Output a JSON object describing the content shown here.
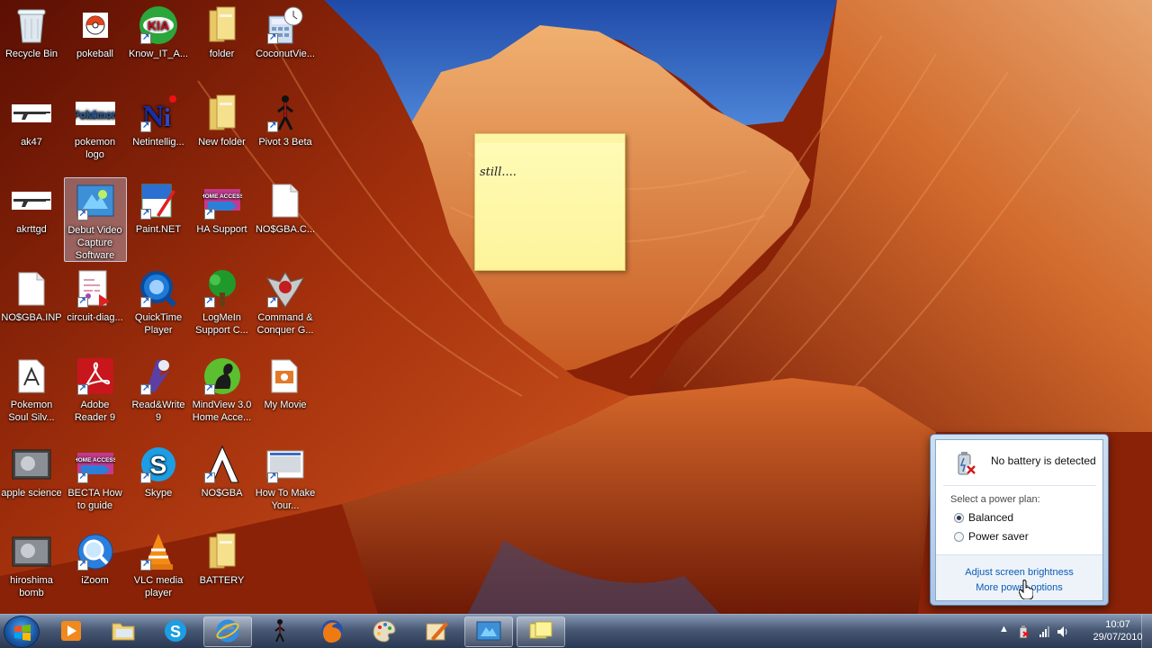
{
  "desktop": {
    "icons": [
      {
        "label": "Recycle Bin",
        "icon": "recycle-bin-icon"
      },
      {
        "label": "pokeball",
        "icon": "pokeball-icon"
      },
      {
        "label": "Know_IT_A...",
        "icon": "kia-icon"
      },
      {
        "label": "folder",
        "icon": "folder-icon"
      },
      {
        "label": "CoconutVie...",
        "icon": "calculator-icon"
      },
      {
        "label": "ak47",
        "icon": "rifle-icon"
      },
      {
        "label": "pokemon logo",
        "icon": "pokemon-logo-icon"
      },
      {
        "label": "Netintellig...",
        "icon": "netintelligence-icon"
      },
      {
        "label": "New folder",
        "icon": "folder-icon"
      },
      {
        "label": "Pivot 3 Beta",
        "icon": "stick-figure-icon"
      },
      {
        "label": "akrttgd",
        "icon": "rifle-icon"
      },
      {
        "label": "Debut Video Capture Software",
        "icon": "debut-video-icon"
      },
      {
        "label": "Paint.NET",
        "icon": "paint-net-icon"
      },
      {
        "label": "HA Support",
        "icon": "home-access-icon"
      },
      {
        "label": "NO$GBA.C...",
        "icon": "document-icon"
      },
      {
        "label": "NO$GBA.INP",
        "icon": "document-icon"
      },
      {
        "label": "circuit-diag...",
        "icon": "pdf-document-icon"
      },
      {
        "label": "QuickTime Player",
        "icon": "quicktime-icon"
      },
      {
        "label": "LogMeIn Support C...",
        "icon": "tree-icon"
      },
      {
        "label": "Command & Conquer G...",
        "icon": "command-conquer-icon"
      },
      {
        "label": "Pokemon Soul Silv...",
        "icon": "nds-rom-icon"
      },
      {
        "label": "Adobe Reader 9",
        "icon": "adobe-reader-icon"
      },
      {
        "label": "Read&Write 9",
        "icon": "read-write-icon"
      },
      {
        "label": "MindView 3.0 Home Acce...",
        "icon": "mindview-icon"
      },
      {
        "label": "My Movie",
        "icon": "movie-file-icon"
      },
      {
        "label": "apple science",
        "icon": "video-thumbnail-icon"
      },
      {
        "label": "BECTA How to guide",
        "icon": "home-access-icon"
      },
      {
        "label": "Skype",
        "icon": "skype-icon"
      },
      {
        "label": "NO$GBA",
        "icon": "nosgba-icon"
      },
      {
        "label": "How To Make Your...",
        "icon": "video-file-icon"
      },
      {
        "label": "hiroshima bomb",
        "icon": "video-thumbnail-icon"
      },
      {
        "label": "iZoom",
        "icon": "izoom-icon"
      },
      {
        "label": "VLC media player",
        "icon": "vlc-icon"
      },
      {
        "label": "BATTERY",
        "icon": "folder-icon"
      }
    ],
    "selected_icon": "Debut Video Capture Software"
  },
  "sticky_note": {
    "text": "still...."
  },
  "power_popup": {
    "status": "No battery is detected",
    "prompt": "Select a power plan:",
    "plans": [
      {
        "label": "Balanced",
        "selected": true
      },
      {
        "label": "Power saver",
        "selected": false
      }
    ],
    "link_brightness": "Adjust screen brightness",
    "link_more": "More power options"
  },
  "taskbar": {
    "start_icon": "windows-logo-icon",
    "pinned": [
      "media-player-icon",
      "explorer-folder-icon",
      "skype-icon",
      "internet-explorer-icon",
      "stick-figure-icon",
      "firefox-icon",
      "paint-palette-icon",
      "sketch-tool-icon",
      "debut-video-icon",
      "sticky-notes-icon"
    ],
    "active": [
      "internet-explorer-icon",
      "debut-video-icon",
      "sticky-notes-icon"
    ],
    "clock_time": "10:07",
    "clock_date": "29/07/2010"
  },
  "colors": {
    "link": "#0b5bb5",
    "taskbar": "#2b3a55",
    "sticky": "#fdf49a"
  }
}
